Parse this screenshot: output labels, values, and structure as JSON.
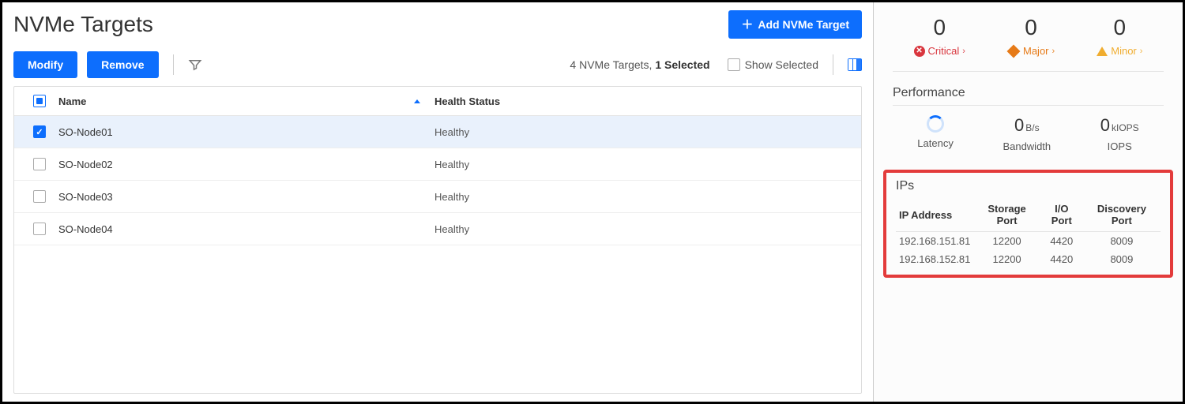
{
  "header": {
    "title": "NVMe Targets",
    "add_button": "Add NVMe Target"
  },
  "toolbar": {
    "modify": "Modify",
    "remove": "Remove",
    "summary_prefix": "4 NVMe Targets, ",
    "summary_selected": "1 Selected",
    "show_selected": "Show Selected"
  },
  "table": {
    "headers": {
      "name": "Name",
      "health": "Health Status"
    },
    "rows": [
      {
        "checked": true,
        "name": "SO-Node01",
        "health": "Healthy"
      },
      {
        "checked": false,
        "name": "SO-Node02",
        "health": "Healthy"
      },
      {
        "checked": false,
        "name": "SO-Node03",
        "health": "Healthy"
      },
      {
        "checked": false,
        "name": "SO-Node04",
        "health": "Healthy"
      }
    ]
  },
  "alarms": {
    "critical": {
      "count": "0",
      "label": "Critical"
    },
    "major": {
      "count": "0",
      "label": "Major"
    },
    "minor": {
      "count": "0",
      "label": "Minor"
    }
  },
  "performance": {
    "title": "Performance",
    "latency_label": "Latency",
    "bandwidth_value": "0",
    "bandwidth_unit": "B/s",
    "bandwidth_label": "Bandwidth",
    "iops_value": "0",
    "iops_unit": "kIOPS",
    "iops_label": "IOPS"
  },
  "ips": {
    "title": "IPs",
    "headers": {
      "ip": "IP Address",
      "storage": "Storage Port",
      "io": "I/O Port",
      "discovery": "Discovery Port"
    },
    "rows": [
      {
        "ip": "192.168.151.81",
        "storage": "12200",
        "io": "4420",
        "discovery": "8009"
      },
      {
        "ip": "192.168.152.81",
        "storage": "12200",
        "io": "4420",
        "discovery": "8009"
      }
    ]
  }
}
